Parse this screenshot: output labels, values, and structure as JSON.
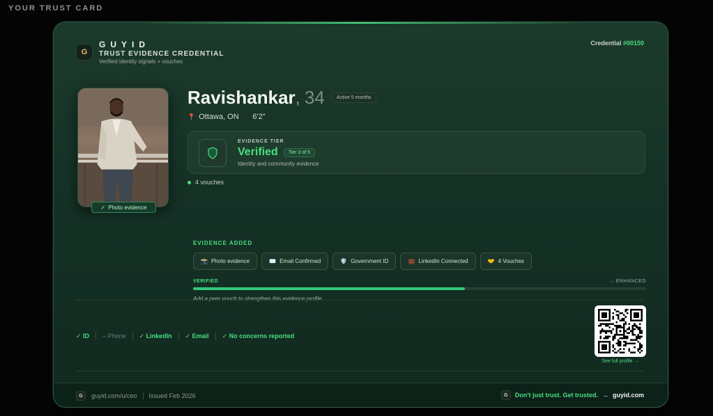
{
  "page": {
    "heading": "YOUR TRUST CARD"
  },
  "brand": {
    "logo_letter": "G",
    "name": "GUYID",
    "subtitle": "TRUST EVIDENCE CREDENTIAL",
    "tagline": "Verified identity signals + vouches"
  },
  "credential": {
    "label": "Credential",
    "number": "#00150"
  },
  "photo": {
    "badge_check": "✓",
    "badge_label": "Photo evidence"
  },
  "profile": {
    "name": "Ravishankar",
    "age": "34",
    "active": "Active 5 months",
    "location_icon": "pin-icon",
    "location": "Ottawa, ON",
    "height": "6'2\""
  },
  "tier": {
    "label": "EVIDENCE TIER",
    "name": "Verified",
    "badge": "Tier 3 of 5",
    "description": "Identity and community evidence",
    "icon": "shield-icon"
  },
  "vouches": {
    "text": "4 vouches"
  },
  "evidence": {
    "heading": "EVIDENCE ADDED",
    "chips": [
      {
        "icon": "📸",
        "label": "Photo evidence"
      },
      {
        "icon": "✉️",
        "label": "Email Confirmed"
      },
      {
        "icon": "🛡️",
        "label": "Government ID"
      },
      {
        "icon": "💼",
        "label": "LinkedIn Connected"
      },
      {
        "icon": "🤝",
        "label": "4 Vouches"
      }
    ]
  },
  "progress": {
    "start_label": "VERIFIED",
    "end_label": "→ ENHANCED",
    "value": 0.6,
    "hint": "Add a peer vouch to strengthen this evidence profile"
  },
  "signals": {
    "items": [
      {
        "label": "✓ ID",
        "active": true
      },
      {
        "label": "– Phone",
        "active": false
      },
      {
        "label": "✓ LinkedIn",
        "active": true
      },
      {
        "label": "✓ Email",
        "active": true
      },
      {
        "label": "✓ No concerns reported",
        "active": true
      }
    ]
  },
  "qr": {
    "caption": "See full profile →"
  },
  "footer": {
    "logo_letter": "G",
    "url": "guyid.com/u/ceo",
    "issued": "Issued Feb 2026",
    "tagline": "Don't just trust. Get trusted.",
    "arrow": "→",
    "site": "guyid.com"
  },
  "colors": {
    "accent": "#4ade80",
    "card_bg": "#163328",
    "page_bg": "#050505"
  }
}
